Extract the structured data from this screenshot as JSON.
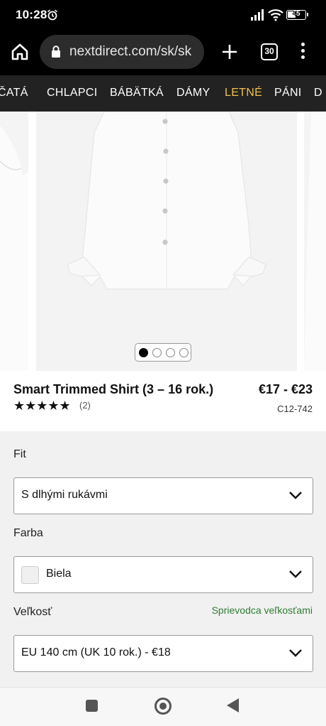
{
  "status": {
    "time": "10:28",
    "battery": "45"
  },
  "browser": {
    "url": "nextdirect.com/sk/sk",
    "tab_count": "30"
  },
  "categories": [
    {
      "label": "ČATÁ"
    },
    {
      "label": "CHLAPCI"
    },
    {
      "label": "BÁBÄTKÁ"
    },
    {
      "label": "DÁMY"
    },
    {
      "label": "LETNÉ",
      "active": true
    },
    {
      "label": "PÁNI"
    },
    {
      "label": "D"
    }
  ],
  "product": {
    "title": "Smart Trimmed Shirt (3 – 16 rok.)",
    "price": "€17 - €23",
    "stars": "★★★★★",
    "rating_count": "(2)",
    "code": "C12-742",
    "gallery_index": 1,
    "gallery_total": 4
  },
  "options": {
    "fit": {
      "label": "Fit",
      "value": "S dlhými rukávmi"
    },
    "color": {
      "label": "Farba",
      "value": "Biela",
      "swatch": "#f0f0f0"
    },
    "size": {
      "label": "Veľkosť",
      "guide": "Sprievodca veľkosťami",
      "value": "EU 140 cm (UK 10 rok.) - €18"
    }
  },
  "colors": {
    "accent_nav": "#f2c14e",
    "size_guide": "#2e7d32"
  }
}
